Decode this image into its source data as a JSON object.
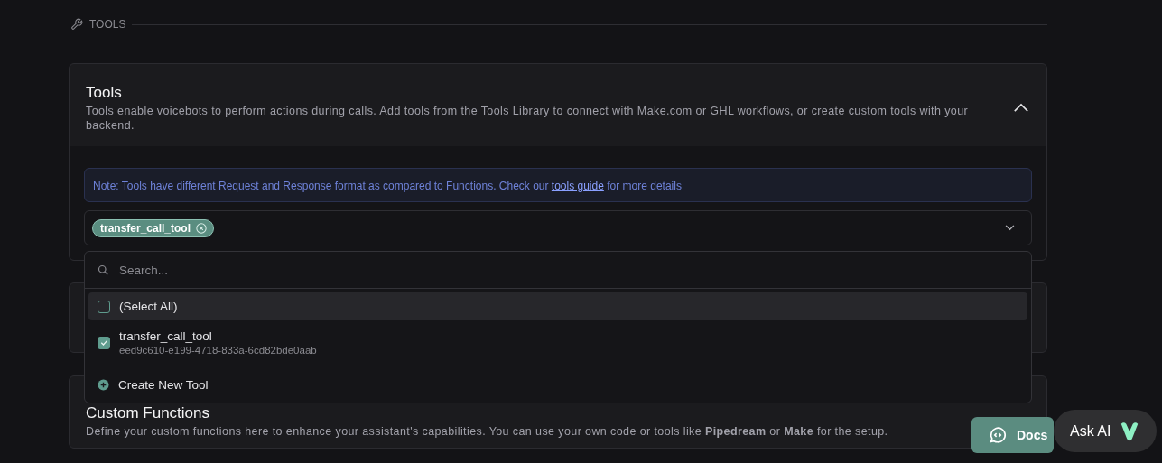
{
  "section_label": "TOOLS",
  "tools_card": {
    "title": "Tools",
    "description": "Tools enable voicebots to perform actions during calls. Add tools from the Tools Library to connect with Make.com or GHL workflows, or create custom tools with your backend.",
    "expanded": true,
    "note": {
      "text": "Note: Tools have different Request and Response format as compared to Functions. Check our",
      "link": "tools guide",
      "after": "for more details"
    },
    "selected_tags": [
      "transfer_call_tool"
    ],
    "dropdown": {
      "search_placeholder": "Search...",
      "options": [
        {
          "kind": "select_all",
          "label": "(Select All)",
          "checked": false,
          "highlighted": true
        },
        {
          "kind": "tool",
          "label": "transfer_call_tool",
          "sub": "eed9c610-e199-4718-833a-6cd82bde0aab",
          "checked": true,
          "highlighted": false
        }
      ],
      "create_label": "Create New Tool"
    }
  },
  "custom_functions_card": {
    "title": "Custom Functions",
    "description": "Define your custom functions here to enhance your assistant's capabilities. You can use your own code or tools like **Pipedream** or **Make** for the setup.",
    "expanded": false
  },
  "docs_button": "Docs",
  "ask_ai_button": "Ask AI"
}
